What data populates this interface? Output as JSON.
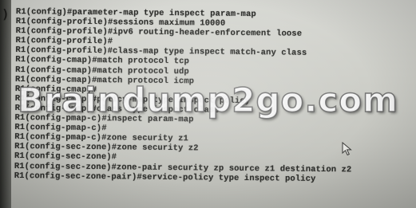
{
  "bezel_glyph": ")",
  "terminal": {
    "lines": [
      "R1(config)#parameter-map type inspect param-map",
      "R1(config-profile)#sessions maximum 10000",
      "R1(config-profile)#ipv6 routing-header-enforcement loose",
      "R1(config-profile)#",
      "R1(config-profile)#class-map type inspect match-any class",
      "R1(config-cmap)#match protocol tcp",
      "R1(config-cmap)#match protocol udp",
      "R1(config-cmap)#match protocol icmp",
      "R1(config-cmap)#",
      "R1(config-cmap)#policy-map type inspect policy",
      "R1(config-pmap)#class type inspect class",
      "R1(config-pmap-c)#inspect param-map",
      "R1(config-pmap-c)#",
      "R1(config-pmap-c)#zone security z1",
      "R1(config-sec-zone)#zone security z2",
      "R1(config-sec-zone)#",
      "R1(config-sec-zone)#zone-pair security zp source z1 destination z2",
      "R1(config-sec-zone-pair)#service-policy type inspect policy"
    ]
  },
  "watermark": "Braindump2go.com",
  "cursor": {
    "icon": "mouse-pointer-icon"
  }
}
